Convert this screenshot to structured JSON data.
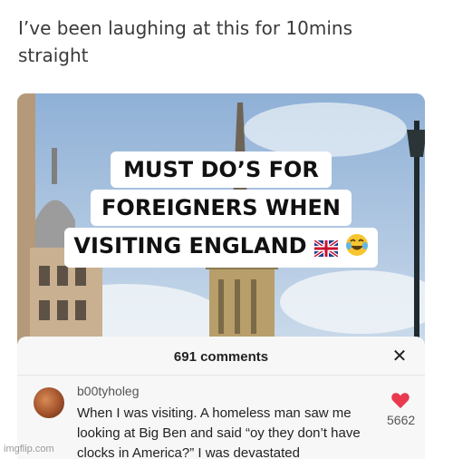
{
  "post": {
    "caption": "I’ve been laughing at this for 10mins straight"
  },
  "video": {
    "title_lines": [
      "MUST DO’S FOR",
      "FOREIGNERS WHEN",
      "VISITING  ENGLAND"
    ],
    "title_emojis": [
      "uk-flag-icon",
      "tears-of-joy-icon"
    ]
  },
  "comments_panel": {
    "count_label": "691 comments",
    "close_icon": "close-icon",
    "comment": {
      "username": "b00tyholeg",
      "text": "When I was visiting. A homeless man saw me looking at Big Ben and said “oy they don’t have clocks in America?” I was devastated",
      "like_count": "5662",
      "like_icon": "heart-icon",
      "like_color": "#e8394f"
    }
  },
  "watermark": "imgflip.com"
}
